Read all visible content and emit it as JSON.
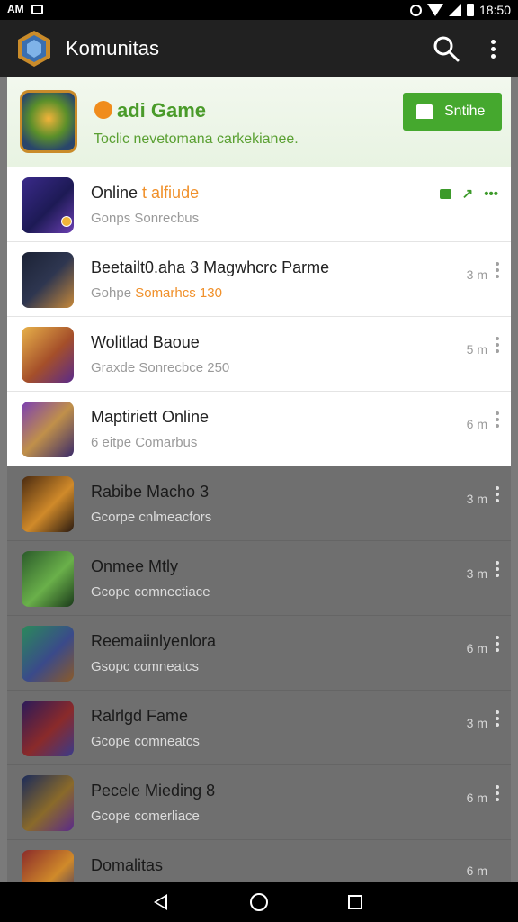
{
  "status_bar": {
    "time": "18:50",
    "left_text": "AM"
  },
  "app_bar": {
    "title": "Komunitas",
    "logo_icon": "hex-shield-icon"
  },
  "featured": {
    "title": "adi Game",
    "subtitle": "Toclic nevetomana carkekianee.",
    "button_label": "Sntihe",
    "accent": "#45a82e"
  },
  "rows": [
    {
      "title_main": "Online",
      "title_accent": "t alfiude",
      "sub": "Gonps Sonrecbus",
      "sub_accent": "",
      "meta": "",
      "gradient": "linear-gradient(135deg,#3a2a8a,#1d1a55 55%,#6b3fb3)"
    },
    {
      "title_main": "Beetailt0.aha 3 Magwhcrc Parme",
      "title_accent": "",
      "sub": "Gohpe",
      "sub_accent": "Somarhcs 130",
      "meta": "3 m",
      "gradient": "linear-gradient(135deg,#1b2235,#2e3650 50%,#c7893a)"
    },
    {
      "title_main": "Wolitlad Baoue",
      "title_accent": "",
      "sub": "Graxde Sonrecbce 250",
      "sub_accent": "",
      "meta": "5 m",
      "gradient": "linear-gradient(135deg,#e8b24a,#a54f2a 55%,#5a2a8a)"
    },
    {
      "title_main": "Maptiriett Online",
      "title_accent": "",
      "sub": "6 eitpe Comarbus",
      "sub_accent": "",
      "meta": "6 m",
      "gradient": "linear-gradient(135deg,#7b3fb3,#c0904a 50%,#3a2a6a)"
    },
    {
      "title_main": "Rabibe Macho 3",
      "title_accent": "",
      "sub": "Gcorpe cnlmeacfors",
      "sub_accent": "",
      "meta": "3 m",
      "gradient": "linear-gradient(135deg,#4a2a10,#d08a2a 55%,#2a1a10)"
    },
    {
      "title_main": "Onmee Mtly",
      "title_accent": "",
      "sub": "Gcope comnectiace",
      "sub_accent": "",
      "meta": "3 m",
      "gradient": "linear-gradient(135deg,#2a5a2a,#6ab04a 55%,#1a3a1a)"
    },
    {
      "title_main": "Reemaiinlyenlora",
      "title_accent": "",
      "sub": "Gsopc comneatcs",
      "sub_accent": "",
      "meta": "6 m",
      "gradient": "linear-gradient(135deg,#2a8a5a,#3a4a8a 55%,#8a5a2a)"
    },
    {
      "title_main": "Ralrlgd Fame",
      "title_accent": "",
      "sub": "Gcope comneatcs",
      "sub_accent": "",
      "meta": "3 m",
      "gradient": "linear-gradient(135deg,#2a1a5a,#8a2a2a 55%,#3a3a8a)"
    },
    {
      "title_main": "Pecele Mieding 8",
      "title_accent": "",
      "sub": "Gcope comerliace",
      "sub_accent": "",
      "meta": "6 m",
      "gradient": "linear-gradient(135deg,#1a2a5a,#8a6a2a 55%,#5a2a8a)"
    },
    {
      "title_main": "Domalitas",
      "title_accent": "",
      "sub": "",
      "sub_accent": "",
      "meta": "6 m",
      "gradient": "linear-gradient(135deg,#8a2a2a,#d08a2a 55%,#2a2a6a)"
    }
  ]
}
